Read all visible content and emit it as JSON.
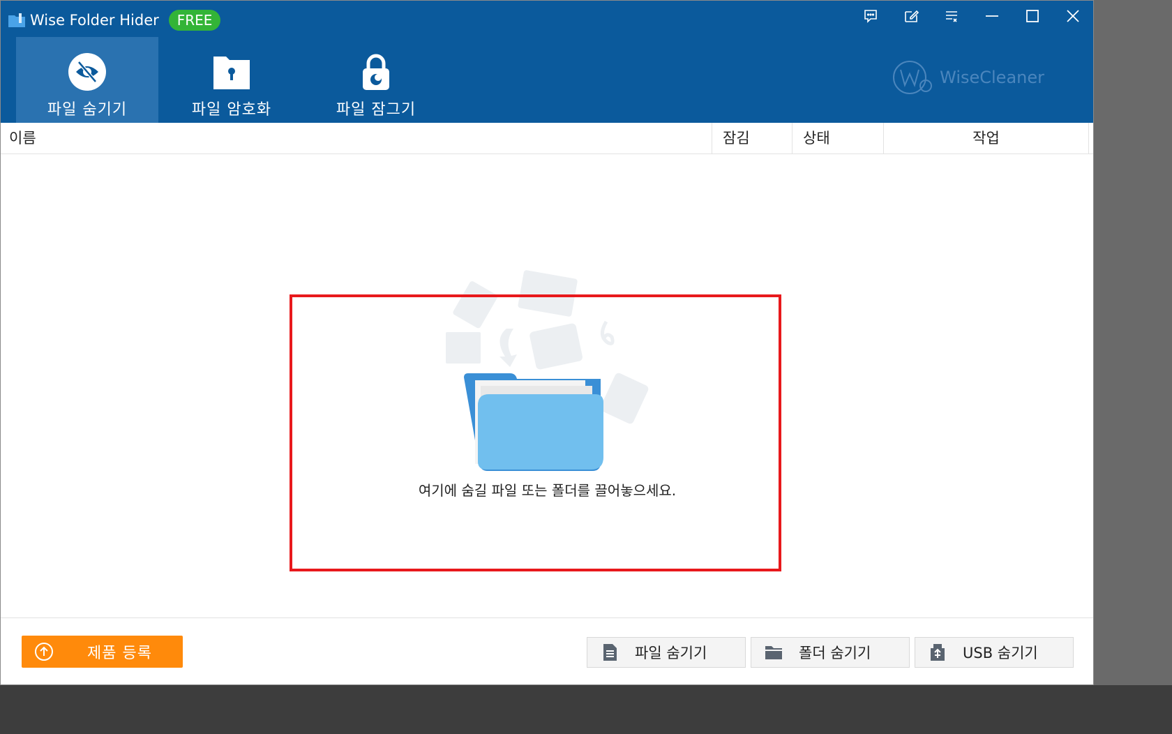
{
  "app": {
    "name": "Wise Folder Hider",
    "badge": "FREE",
    "brand": "WiseCleaner"
  },
  "nav": {
    "tabs": [
      {
        "label": "파일 숨기기",
        "icon": "eye-slash-icon",
        "active": true
      },
      {
        "label": "파일 암호화",
        "icon": "folder-key-icon",
        "active": false
      },
      {
        "label": "파일 잠그기",
        "icon": "padlock-icon",
        "active": false
      }
    ]
  },
  "title_controls": [
    "feedback-icon",
    "edit-icon",
    "menu-icon",
    "minimize-icon",
    "maximize-icon",
    "close-icon"
  ],
  "table": {
    "columns": [
      "이름",
      "잠김",
      "상태",
      "작업"
    ]
  },
  "drop_zone": {
    "text": "여기에 숨길 파일 또는 폴더를 끌어놓으세요."
  },
  "footer": {
    "register_label": "제품 등록",
    "buttons": [
      {
        "label": "파일 숨기기",
        "icon": "file-icon"
      },
      {
        "label": "폴더 숨기기",
        "icon": "folder-icon"
      },
      {
        "label": "USB 숨기기",
        "icon": "usb-icon"
      }
    ]
  },
  "colors": {
    "header": "#0b5a9c",
    "active_tab": "#2a72b0",
    "badge": "#33b437",
    "register": "#ff8a0b",
    "highlight": "#e8191c"
  }
}
